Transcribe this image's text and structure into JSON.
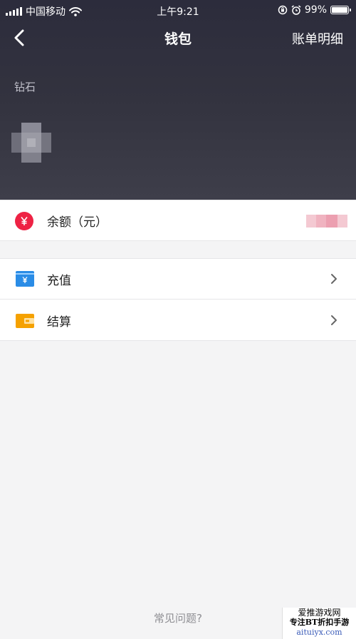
{
  "status_bar": {
    "carrier": "中国移动",
    "time": "上午9:21",
    "battery": "99%",
    "battery_level": 0.99
  },
  "nav": {
    "title": "钱包",
    "right_action": "账单明细"
  },
  "header": {
    "section_label": "钻石"
  },
  "balance": {
    "label": "余额（元）",
    "icon": "yuan-circle-icon"
  },
  "menu": [
    {
      "label": "充值",
      "icon": "recharge-card-icon"
    },
    {
      "label": "结算",
      "icon": "wallet-icon"
    }
  ],
  "footer": {
    "faq": "常见问题?"
  },
  "watermark": {
    "line1": "爱推游戏网",
    "line2": "专注BT折扣手游",
    "line3": "aituiyx.com"
  },
  "colors": {
    "header_dark": "#2c2c3c",
    "balance_icon": "#ee2244",
    "recharge_icon": "#2a8ce6",
    "wallet_icon": "#f5a100"
  }
}
